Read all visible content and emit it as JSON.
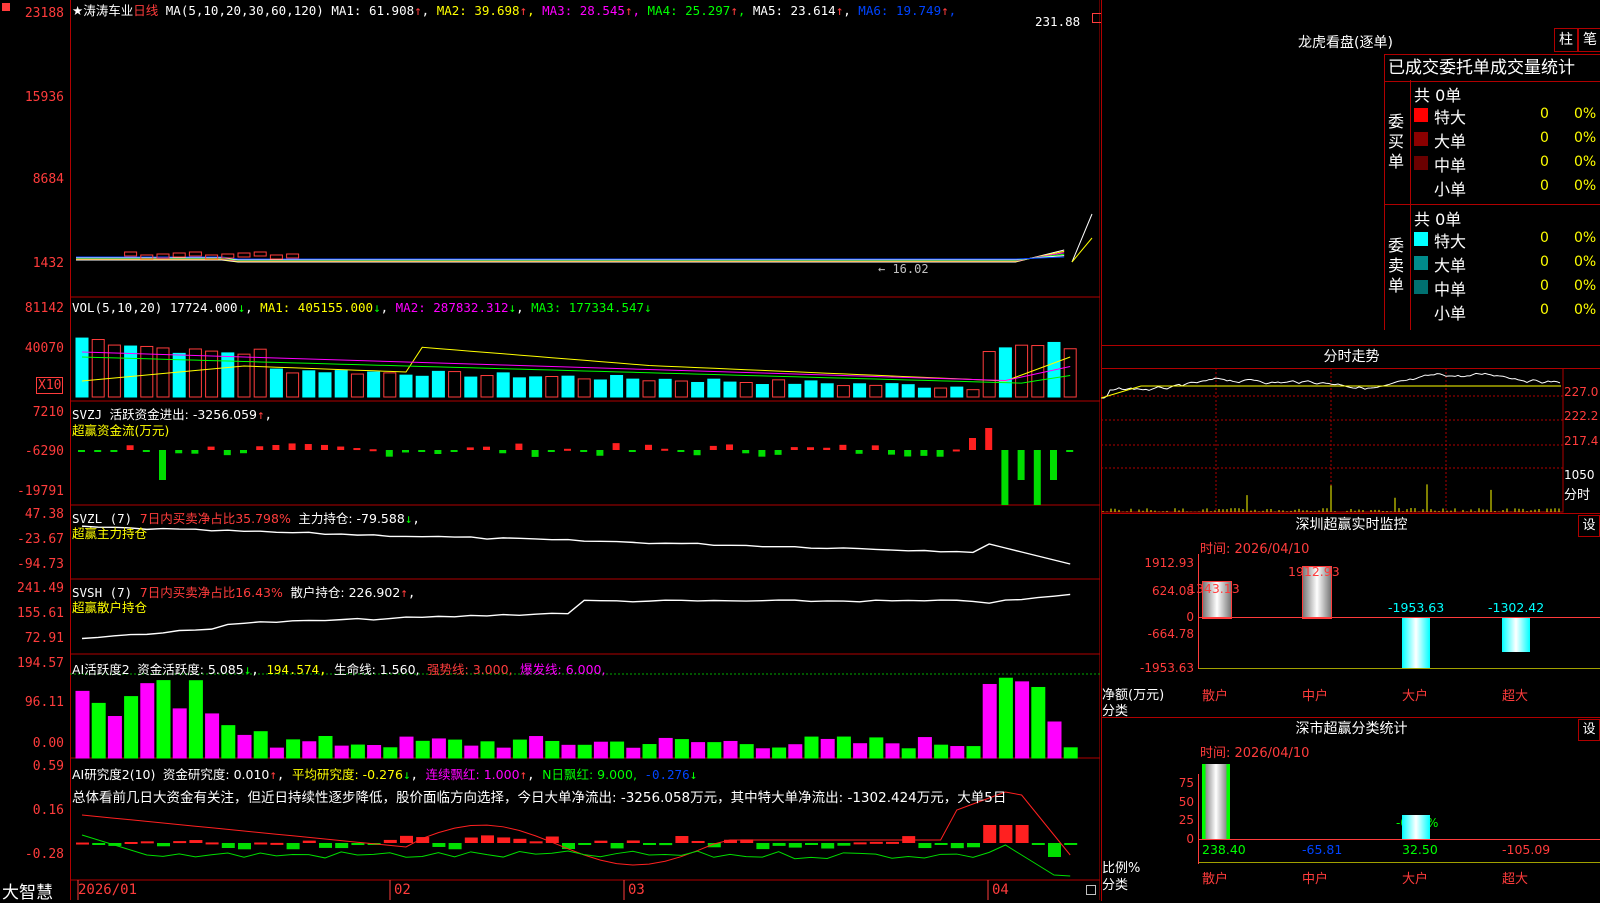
{
  "header": {
    "stock_name": "★涛涛车业",
    "period": "日线",
    "ma_label": "MA(5,10,20,30,60,120)",
    "ma": [
      {
        "name": "MA1:",
        "value": "61.908",
        "color": "#ffffff"
      },
      {
        "name": "MA2:",
        "value": "39.698",
        "color": "#ffff00"
      },
      {
        "name": "MA3:",
        "value": "28.545",
        "color": "#ff00ff"
      },
      {
        "name": "MA4:",
        "value": "25.297",
        "color": "#00ff00"
      },
      {
        "name": "MA5:",
        "value": "23.614",
        "color": "#ffffff"
      },
      {
        "name": "MA6:",
        "value": "19.749",
        "color": "#0044ff"
      }
    ],
    "arrow_up": "↑",
    "arrow_down": "↓",
    "high_price": "231.88",
    "low_price": "16.02"
  },
  "main_axis": [
    "23188",
    "15936",
    "8684",
    "1432"
  ],
  "vol": {
    "label": "VOL(5,10,20)",
    "value": "17724.000",
    "ma1": "MA1: 405155.000",
    "ma2": "MA2: 287832.312",
    "ma3": "MA3: 177334.547",
    "axis": [
      "81142",
      "40070"
    ],
    "unit": "X10"
  },
  "svzj": {
    "label": "SVZJ",
    "desc": "活跃资金进出: -3256.059",
    "sub": "超赢资金流(万元)",
    "axis": [
      "7210",
      "-6290",
      "-19791"
    ]
  },
  "svzl": {
    "label": "SVZL (7)",
    "desc1": "7日内买卖净占比35.798%",
    "desc2": "主力持仓: -79.588",
    "sub": "超赢主力持仓",
    "axis": [
      "47.38",
      "-23.67",
      "-94.73"
    ]
  },
  "svsh": {
    "label": "SVSH (7)",
    "desc1": "7日内买卖净占比16.43%",
    "desc2": "散户持仓: 226.902",
    "sub": "超赢散户持仓",
    "axis": [
      "241.49",
      "155.61",
      "72.91"
    ]
  },
  "ai1": {
    "label": "AI活跃度2",
    "d1": "资金活跃度: 5.085",
    "d2": "194.574,",
    "d3": "生命线: 1.560,",
    "d4": "强势线: 3.000,",
    "d5": "爆发线: 6.000,",
    "axis": [
      "194.57",
      "96.11",
      "0.00"
    ]
  },
  "ai2": {
    "label": "AI研究度2(10)",
    "d1": "资金研究度: 0.010",
    "d2": "平均研究度: -0.276",
    "d3": "连续飘红: 1.000",
    "d4": "N日飘红: 9.000,",
    "d5": "-0.276",
    "text": "总体看前几日大资金有关注，但近日持续性逐步降低，股价面临方向选择，今日大单净流出: -3256.058万元，其中特大单净流出: -1302.424万元，大单5日",
    "axis": [
      "0.59",
      "0.16",
      "-0.28"
    ]
  },
  "xaxis": [
    "2026/01",
    "02",
    "03",
    "04"
  ],
  "brand": "大智慧",
  "lhb": {
    "title": "龙虎看盘(逐单)",
    "btn1": "柱",
    "btn2": "笔",
    "subtitle": "已成交委托单成交量统计",
    "buy": {
      "side": "委买单",
      "total": "共 0单",
      "rows": [
        {
          "label": "特大",
          "count": "0",
          "pct": "0%",
          "color": "#ff0000"
        },
        {
          "label": "大单",
          "count": "0",
          "pct": "0%",
          "color": "#8b0000"
        },
        {
          "label": "中单",
          "count": "0",
          "pct": "0%",
          "color": "#6a0000"
        },
        {
          "label": "小单",
          "count": "0",
          "pct": "0%",
          "color": ""
        }
      ]
    },
    "sell": {
      "side": "委卖单",
      "total": "共 0单",
      "rows": [
        {
          "label": "特大",
          "count": "0",
          "pct": "0%",
          "color": "#00ffff"
        },
        {
          "label": "大单",
          "count": "0",
          "pct": "0%",
          "color": "#008b8b"
        },
        {
          "label": "中单",
          "count": "0",
          "pct": "0%",
          "color": "#007070"
        },
        {
          "label": "小单",
          "count": "0",
          "pct": "0%",
          "color": ""
        }
      ]
    }
  },
  "intraday": {
    "title": "分时走势",
    "axis": [
      "227.0",
      "222.2",
      "217.4",
      "1050"
    ],
    "unit": "分时"
  },
  "sz_monitor": {
    "title": "深圳超赢实时监控",
    "btn": "设",
    "date": "时间: 2026/04/10",
    "axis": [
      "1912.93",
      "624.08",
      "0",
      "-664.78",
      "-1953.63"
    ],
    "ylabel": "净额(万元)",
    "xlabel": "分类",
    "bars": [
      {
        "cat": "散户",
        "value": "1343.13",
        "num": 1343.13
      },
      {
        "cat": "中户",
        "value": "1912.93",
        "num": 1912.93
      },
      {
        "cat": "大户",
        "value": "-1953.63",
        "num": -1953.63
      },
      {
        "cat": "超大",
        "value": "-1302.42",
        "num": -1302.42
      }
    ]
  },
  "sh_stat": {
    "title": "深市超赢分类统计",
    "btn": "设",
    "date": "时间: 2026/04/10",
    "axis": [
      "75",
      "50",
      "25",
      "0"
    ],
    "ylabel": "比例%",
    "xlabel": "分类",
    "bar_label": "-0.24%",
    "bars": [
      {
        "cat": "散户",
        "value": "238.40",
        "num": 100,
        "color": "#00ff00"
      },
      {
        "cat": "中户",
        "value": "-65.81",
        "num": 0,
        "color": "#0044ff"
      },
      {
        "cat": "大户",
        "value": "32.50",
        "num": 32.5,
        "color": "#00ff00"
      },
      {
        "cat": "超大",
        "value": "-105.09",
        "num": 0,
        "color": "#ff3c3c"
      }
    ]
  }
}
